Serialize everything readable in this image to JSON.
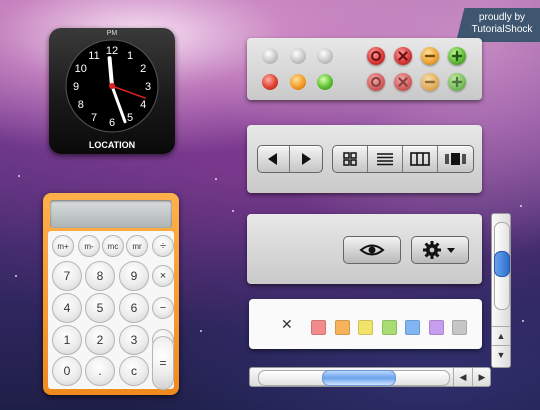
{
  "ribbon": {
    "line1": "proudly by",
    "line2": "TutorialShock"
  },
  "clock": {
    "ampm": "PM",
    "location": "LOCATION",
    "numbers": [
      "12",
      "1",
      "2",
      "3",
      "4",
      "5",
      "6",
      "7",
      "8",
      "9",
      "10",
      "11"
    ],
    "hour_hand_deg": 355,
    "minute_hand_deg": 160,
    "second_hand_deg": 110
  },
  "dots_panel": {
    "row1": [
      "grey",
      "grey",
      "grey"
    ],
    "row2": [
      "red",
      "orange",
      "green"
    ],
    "action_buttons": [
      {
        "color": "red",
        "icon": "record-icon"
      },
      {
        "color": "red",
        "icon": "close-icon"
      },
      {
        "color": "orange",
        "icon": "minus-icon"
      },
      {
        "color": "green",
        "icon": "plus-icon"
      }
    ]
  },
  "toolbar": {
    "nav": [
      "back-arrow-icon",
      "forward-arrow-icon"
    ],
    "views": [
      "grid-view-icon",
      "list-view-icon",
      "columns-view-icon",
      "coverflow-view-icon"
    ]
  },
  "actions": {
    "eye_icon": "eye-icon",
    "gear_icon": "gear-icon",
    "menu_icon": "chevron-down-icon"
  },
  "color_labels": {
    "clear_symbol": "✕",
    "colors": [
      "#f28b8b",
      "#f5b35a",
      "#f2e36b",
      "#a8dd72",
      "#7fb5f2",
      "#c79df0",
      "#c6c6c6"
    ]
  },
  "calculator": {
    "row1": [
      "m+",
      "m-",
      "mc",
      "mr",
      "÷"
    ],
    "row2": [
      "7",
      "8",
      "9",
      "×"
    ],
    "row3": [
      "4",
      "5",
      "6",
      "−"
    ],
    "row4": [
      "1",
      "2",
      "3",
      "+"
    ],
    "row5": [
      "0",
      ".",
      "c",
      "="
    ]
  },
  "scroll": {
    "up_arrow": "▲",
    "down_arrow": "▼",
    "left_arrow": "◀",
    "right_arrow": "▶"
  }
}
